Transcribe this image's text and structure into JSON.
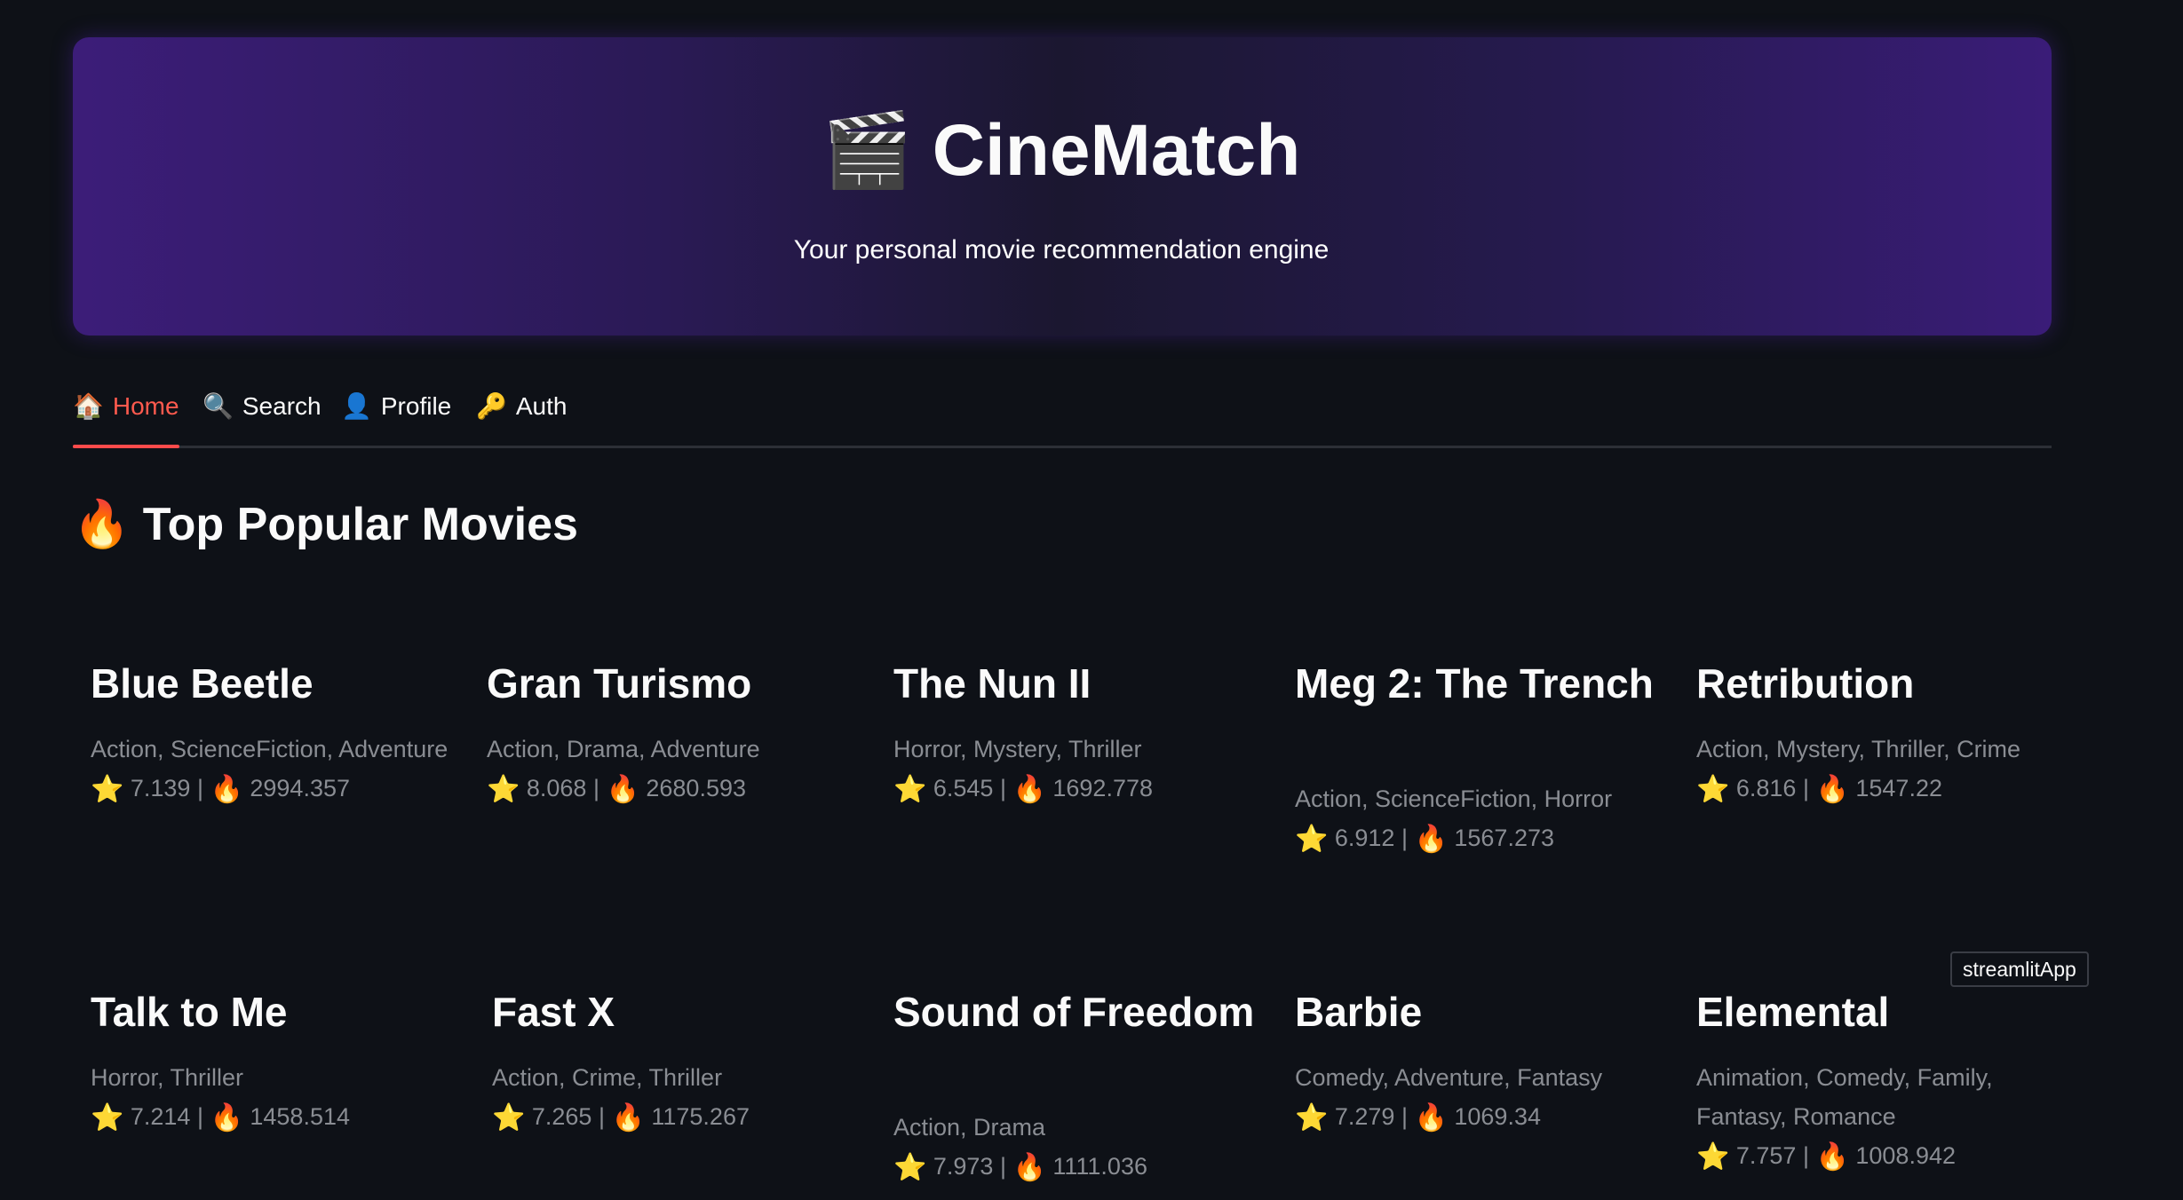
{
  "header": {
    "icon": "🎬",
    "title": "CineMatch",
    "subtitle": "Your personal movie recommendation engine"
  },
  "tabs": [
    {
      "icon": "🏠",
      "label": "Home",
      "active": true
    },
    {
      "icon": "🔍",
      "label": "Search",
      "active": false
    },
    {
      "icon": "👤",
      "label": "Profile",
      "active": false
    },
    {
      "icon": "🔑",
      "label": "Auth",
      "active": false
    }
  ],
  "section": {
    "icon": "🔥",
    "title": "Top Popular Movies"
  },
  "stat_icons": {
    "rating": "⭐",
    "popularity": "🔥",
    "separator": "|"
  },
  "movies": [
    {
      "title": "Blue Beetle",
      "genres": "Action, ScienceFiction, Adventure",
      "rating": "7.139",
      "popularity": "2994.357"
    },
    {
      "title": "Gran Turismo",
      "genres": "Action, Drama, Adventure",
      "rating": "8.068",
      "popularity": "2680.593"
    },
    {
      "title": "The Nun II",
      "genres": "Horror, Mystery, Thriller",
      "rating": "6.545",
      "popularity": "1692.778"
    },
    {
      "title": "Meg 2: The Trench",
      "genres": "Action, ScienceFiction, Horror",
      "rating": "6.912",
      "popularity": "1567.273"
    },
    {
      "title": "Retribution",
      "genres": "Action, Mystery, Thriller, Crime",
      "rating": "6.816",
      "popularity": "1547.22"
    },
    {
      "title": "Talk to Me",
      "genres": "Horror, Thriller",
      "rating": "7.214",
      "popularity": "1458.514"
    },
    {
      "title": "Fast X",
      "genres": "Action, Crime, Thriller",
      "rating": "7.265",
      "popularity": "1175.267"
    },
    {
      "title": "Sound of Freedom",
      "genres": "Action, Drama",
      "rating": "7.973",
      "popularity": "1111.036"
    },
    {
      "title": "Barbie",
      "genres": "Comedy, Adventure, Fantasy",
      "rating": "7.279",
      "popularity": "1069.34"
    },
    {
      "title": "Elemental",
      "genres": "Animation, Comedy, Family, Fantasy, Romance",
      "rating": "7.757",
      "popularity": "1008.942"
    }
  ],
  "badge": "streamlitApp"
}
